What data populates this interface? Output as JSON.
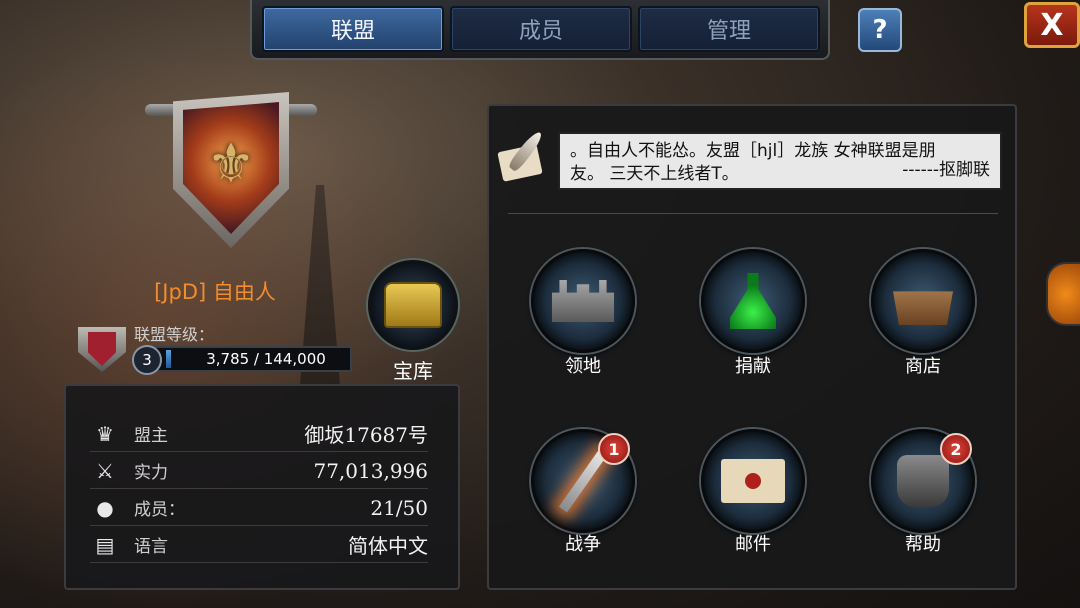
{
  "tabs": [
    {
      "label": "联盟",
      "active": true
    },
    {
      "label": "成员",
      "active": false
    },
    {
      "label": "管理",
      "active": false
    }
  ],
  "help_label": "?",
  "close_label": "X",
  "alliance": {
    "name": "[JpD] 自由人",
    "level_label": "联盟等级：",
    "level": "3",
    "xp_text": "3,785 / 144,000",
    "xp_fraction": 0.026
  },
  "treasury_label": "宝库",
  "stats": [
    {
      "icon": "crown-icon",
      "label": "盟主",
      "value": "御坂17687号"
    },
    {
      "icon": "crossed-swords-icon",
      "label": "实力",
      "value": "77,013,996"
    },
    {
      "icon": "person-icon",
      "label": "成员：",
      "value": "21/50"
    },
    {
      "icon": "speech-bubble-icon",
      "label": "语言",
      "value": "简体中文"
    }
  ],
  "notice": {
    "line1": "。自由人不能怂。友盟［hjl］龙族 女神联盟是朋",
    "line2": "友。 三天不上线者T。",
    "signature": "------抠脚联"
  },
  "actions": [
    {
      "label": "领地",
      "icon": "castle-icon",
      "badge": ""
    },
    {
      "label": "捐献",
      "icon": "potion-icon",
      "badge": ""
    },
    {
      "label": "商店",
      "icon": "shop-icon",
      "badge": ""
    },
    {
      "label": "战争",
      "icon": "sword-icon",
      "badge": "1"
    },
    {
      "label": "邮件",
      "icon": "mail-icon",
      "badge": ""
    },
    {
      "label": "帮助",
      "icon": "gauntlet-icon",
      "badge": "2"
    }
  ],
  "colors": {
    "accent": "#2f5a90",
    "alliance_name": "#f28c2c",
    "badge": "#c02a22"
  }
}
